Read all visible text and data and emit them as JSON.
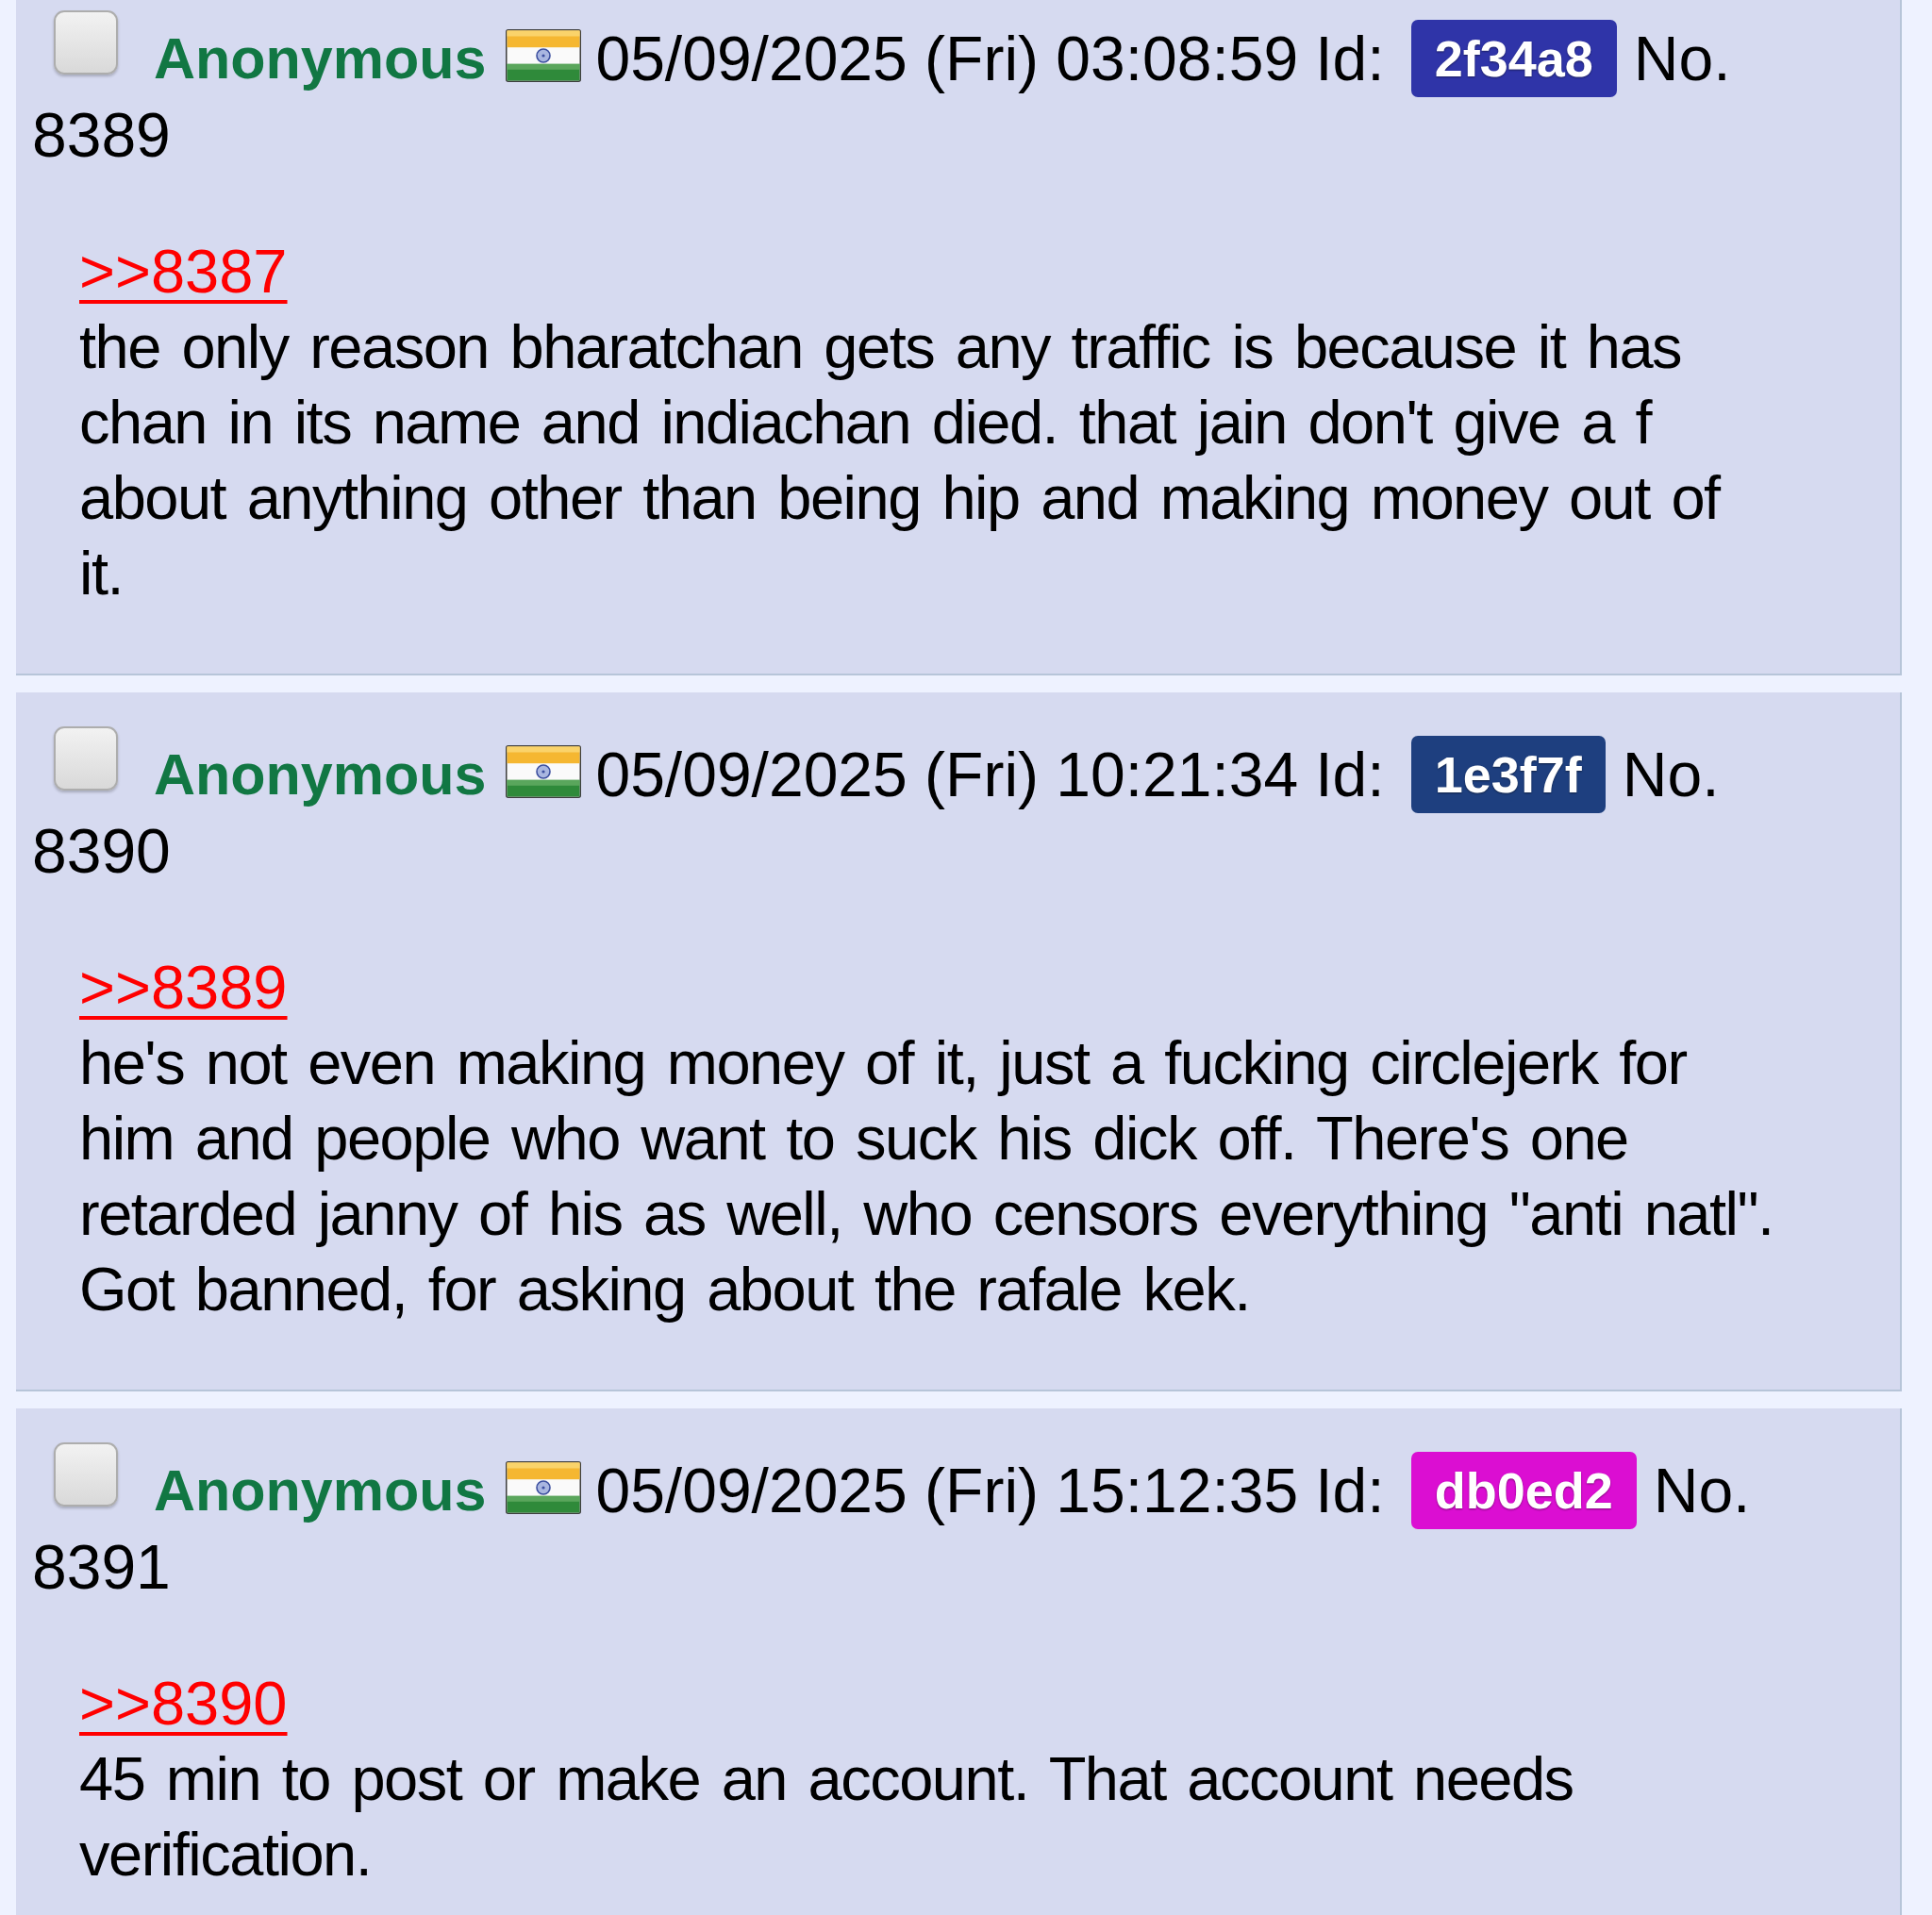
{
  "posts": [
    {
      "checked": false,
      "name": "Anonymous",
      "date": "05/09/2025 (Fri) 03:08:59",
      "id_label": "Id:",
      "poster_id": {
        "text": "2f34a8",
        "color": "#2f34a8"
      },
      "number_label": "No.",
      "number": "8389",
      "reply_to": ">>8387",
      "body": "the only reason bharatchan gets any traffic is because it has chan in its name and indiachan died. that jain don't give a f about anything other than being hip and making money out of it."
    },
    {
      "checked": false,
      "name": "Anonymous",
      "date": "05/09/2025 (Fri) 10:21:34",
      "id_label": "Id:",
      "poster_id": {
        "text": "1e3f7f",
        "color": "#1e3f7f"
      },
      "number_label": "No.",
      "number": "8390",
      "reply_to": ">>8389",
      "body": "he's not even making money of it, just a fucking circlejerk for him and people who want to suck his dick off. There's one retarded janny of his as well, who censors everything \"anti natl\". Got banned, for asking about the rafale kek."
    },
    {
      "checked": false,
      "name": "Anonymous",
      "date": "05/09/2025 (Fri) 15:12:35",
      "id_label": "Id:",
      "poster_id": {
        "text": "db0ed2",
        "color": "#db0ed2"
      },
      "number_label": "No.",
      "number": "8391",
      "reply_to": ">>8390",
      "body": "45 min to post or make an account. That account needs verification."
    }
  ]
}
